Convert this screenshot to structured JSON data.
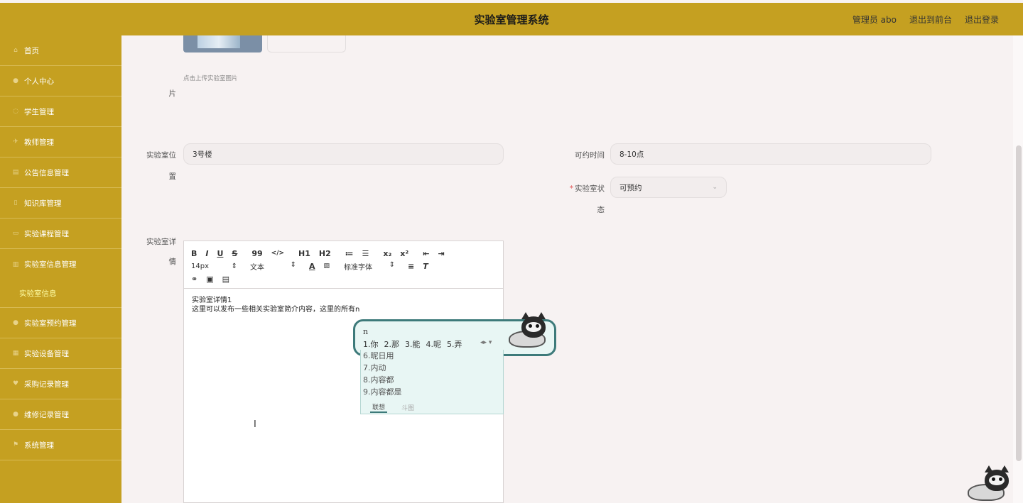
{
  "header": {
    "title": "实验室管理系统",
    "user": "管理员 abo",
    "front_link": "退出到前台",
    "logout": "退出登录"
  },
  "sidebar": {
    "items": [
      {
        "label": "首页",
        "icon": "home-icon"
      },
      {
        "label": "个人中心",
        "icon": "user-icon"
      },
      {
        "label": "学生管理",
        "icon": "student-icon"
      },
      {
        "label": "教师管理",
        "icon": "teacher-icon"
      },
      {
        "label": "公告信息管理",
        "icon": "notice-icon"
      },
      {
        "label": "知识库管理",
        "icon": "book-icon"
      },
      {
        "label": "实验课程管理",
        "icon": "course-icon"
      },
      {
        "label": "实验室信息管理",
        "icon": "chart-icon"
      }
    ],
    "sub_item": "实验室信息",
    "items_after": [
      {
        "label": "实验室预约管理",
        "icon": "reserve-icon"
      },
      {
        "label": "实验设备管理",
        "icon": "device-icon"
      },
      {
        "label": "采购记录管理",
        "icon": "purchase-icon"
      },
      {
        "label": "维修记录管理",
        "icon": "repair-icon"
      },
      {
        "label": "系统管理",
        "icon": "system-icon"
      }
    ]
  },
  "form": {
    "upload_hint": "点击上传实验室图片",
    "image_label_tail": "片",
    "location_label_1": "实验室位",
    "location_label_2": "置",
    "location_value": "3号楼",
    "time_label": "可约时间",
    "time_value": "8-10点",
    "status_label_1": "实验室状",
    "status_label_2": "态",
    "status_value": "可预约",
    "detail_label_1": "实验室详",
    "detail_label_2": "情"
  },
  "editor": {
    "toolbar_row1": [
      "B",
      "I",
      "U",
      "S",
      "99",
      "</>",
      "H1",
      "H2",
      "≔",
      "☰",
      "x₂",
      "x²",
      "⇤",
      "⇥"
    ],
    "font_size": "14px",
    "text_type": "文本",
    "font_family": "标准字体",
    "content_line1": "实验室详情1",
    "content_line2": "这里可以发布一些相关实验室简介内容，这里的所有n"
  },
  "ime": {
    "input": "n",
    "candidates": [
      "1.你",
      "2.那",
      "3.能",
      "4.呢",
      "5.弄"
    ],
    "list": [
      "6.昵日用",
      "7.内动",
      "8.内容都",
      "9.内容都是"
    ],
    "tab_active": "联想",
    "tab_inactive": "斗图"
  },
  "colors": {
    "header_bg": "#c5a021",
    "sidebar_bg": "#c5a021",
    "sub_item": "#ffffa8"
  }
}
